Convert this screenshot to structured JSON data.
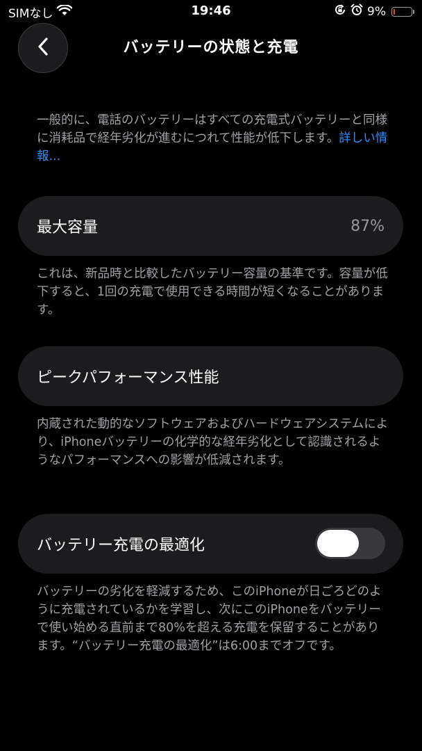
{
  "status_bar": {
    "carrier": "SIMなし",
    "time": "19:46",
    "battery_percent": "9%",
    "battery_level": 0.09,
    "battery_color": "#ff3b30",
    "icons": [
      "wifi-icon",
      "orientation-lock-icon",
      "alarm-icon",
      "battery-icon"
    ]
  },
  "nav": {
    "back_icon": "chevron-left-icon",
    "title": "バッテリーの状態と充電"
  },
  "intro": {
    "text": "一般的に、電話のバッテリーはすべての充電式バッテリーと同様に消耗品で経年劣化が進むにつれて性能が低下します。",
    "link": "詳しい情報..."
  },
  "max_capacity": {
    "label": "最大容量",
    "value": "87%",
    "description": "これは、新品時と比較したバッテリー容量の基準です。容量が低下すると、1回の充電で使用できる時間が短くなることがあります。"
  },
  "peak_performance": {
    "label": "ピークパフォーマンス性能",
    "description": "内蔵された動的なソフトウェアおよびハードウェアシステムにより、iPhoneバッテリーの化学的な経年劣化として認識されるようなパフォーマンスへの影響が低減されます。"
  },
  "optimized_charging": {
    "label": "バッテリー充電の最適化",
    "toggle_on": false,
    "description": "バッテリーの劣化を軽減するため、このiPhoneが日ごろどのように充電されているかを学習し、次にこのiPhoneをバッテリーで使い始める直前まで80%を超える充電を保留することがあります。“バッテリー充電の最適化”は6:00までオフです。"
  },
  "colors": {
    "background": "#000000",
    "card": "#1c1c1e",
    "secondary_text": "#a0a0a5",
    "link": "#2f8cff",
    "toggle_off": "#39393d"
  }
}
